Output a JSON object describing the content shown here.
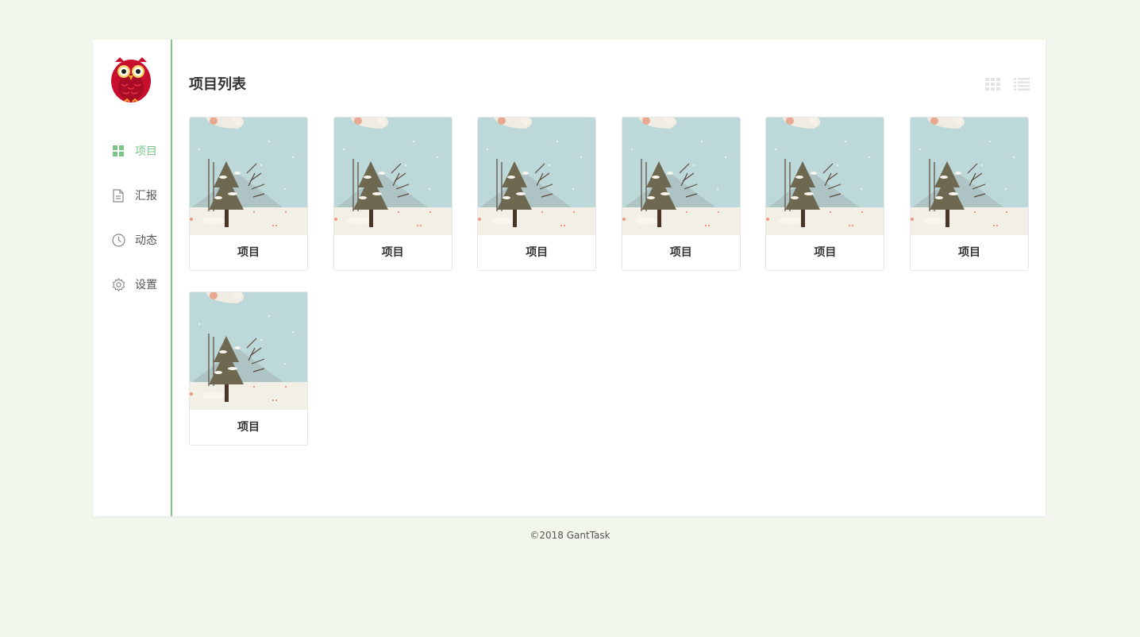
{
  "sidebar": {
    "logo_icon": "owl-logo",
    "items": [
      {
        "label": "项目",
        "icon": "grid-icon",
        "active": true
      },
      {
        "label": "汇报",
        "icon": "document-icon",
        "active": false
      },
      {
        "label": "动态",
        "icon": "clock-icon",
        "active": false
      },
      {
        "label": "设置",
        "icon": "gear-icon",
        "active": false
      }
    ]
  },
  "main": {
    "title": "项目列表",
    "view_toggle": [
      "grid-view-icon",
      "list-view-icon"
    ],
    "projects": [
      {
        "name": "项目"
      },
      {
        "name": "项目"
      },
      {
        "name": "项目"
      },
      {
        "name": "项目"
      },
      {
        "name": "项目"
      },
      {
        "name": "项目"
      },
      {
        "name": "项目"
      }
    ]
  },
  "footer": {
    "text": "©2018 GantTask"
  },
  "colors": {
    "accent": "#7dc48a",
    "background": "#f1f7ec"
  }
}
